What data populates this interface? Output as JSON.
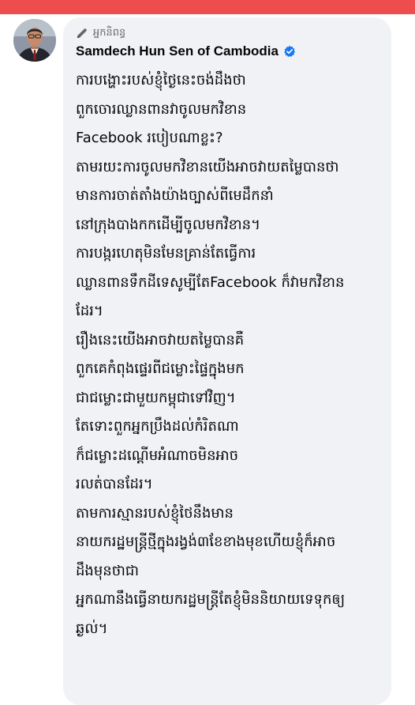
{
  "author_role": "អ្នកនិពន្ធ",
  "page_name": "Samdech Hun Sen of Cambodia",
  "icons": {
    "author_role_icon": "pencil-icon",
    "verified_icon": "verified-badge-icon"
  },
  "colors": {
    "top_bar": "#ee4d4d",
    "bubble": "#f0f2f5",
    "verified": "#1877f2"
  },
  "post_lines": [
    "ការបង្ហោះរបស់ខ្ញុំថ្ងៃនេះចង់ដឹងថា",
    "ពួកចោរឈ្លានពានវាចូលមកវិខាន",
    "Facebook របៀបណាខ្លះ?",
    "តាមរយះការចូលមកវិខានយើងអាចវាយតម្លៃបានថា",
    "មានការចាត់តាំងយ៉ាងច្បាស់ពីមេដឹកនាំ",
    "នៅក្រុងបាងកកដើម្បីចូលមកវិខាន។",
    "ការបង្ករហេតុមិនមែនគ្រាន់តែធ្វើការ",
    "ឈ្លានពានទឹកដីទេសូម្បីតែFacebook ក៏វាមកវិខាន",
    "ដែរ។",
    "រឿងនេះយើងអាចវាយតម្លៃបានគឺ",
    "ពួកគេកំពុងផ្ទេរពីជម្លោះផ្ទៃក្នុងមក",
    "ជាជម្លោះជាមួយកម្ពុជាទៅវិញ។",
    "តែទោះពួកអ្នកប្រឹងដល់កំរិតណា",
    "ក៏ជម្លោះដណ្តើមអំណាចមិនអាច",
    "រលត់បានដែរ។",
    "តាមការស្មានរបស់ខ្ញុំថៃនឹងមាន",
    "នាយករដ្ឋមន្ត្រីថ្មីក្នុងរង្វង់៣ខែខាងមុខហើយខ្ញុំក៏អាច",
    "ដឹងមុនថាជា",
    "អ្នកណានឹងធ្វើនាយករដ្ឋមន្ត្រីតែខ្ញុំមិននិយាយទេទុកឲ្យ",
    "ឆ្ងល់។"
  ]
}
